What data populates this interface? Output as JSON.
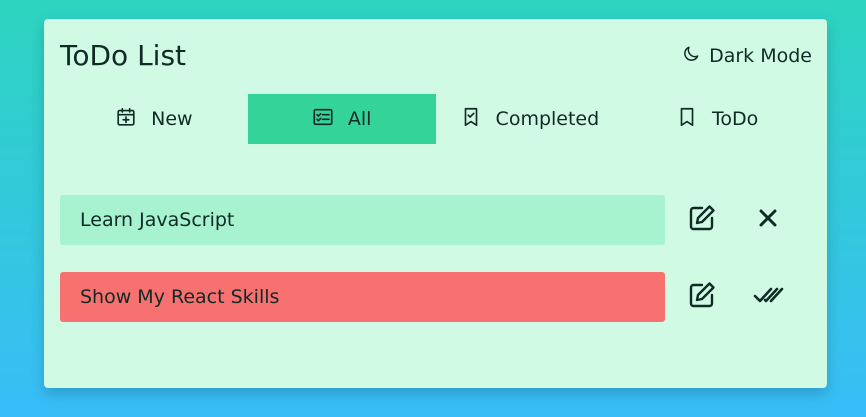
{
  "app": {
    "title": "ToDo List",
    "dark_mode_label": "Dark Mode"
  },
  "tabs": [
    {
      "label": "New",
      "icon": "calendar-plus-icon",
      "active": false
    },
    {
      "label": "All",
      "icon": "list-check-icon",
      "active": true
    },
    {
      "label": "Completed",
      "icon": "bookmark-check-icon",
      "active": false
    },
    {
      "label": "ToDo",
      "icon": "bookmark-icon",
      "active": false
    }
  ],
  "todos": [
    {
      "text": "Learn JavaScript",
      "status": "completed",
      "color": "#a7f3d0",
      "edit_icon": "edit-icon",
      "action_icon": "close-icon"
    },
    {
      "text": "Show My React Skills",
      "status": "todo",
      "color": "#f87171",
      "edit_icon": "edit-icon",
      "action_icon": "double-check-icon"
    }
  ],
  "colors": {
    "card": "#d1fae5",
    "active_tab": "#34d399",
    "text": "#102a26"
  }
}
